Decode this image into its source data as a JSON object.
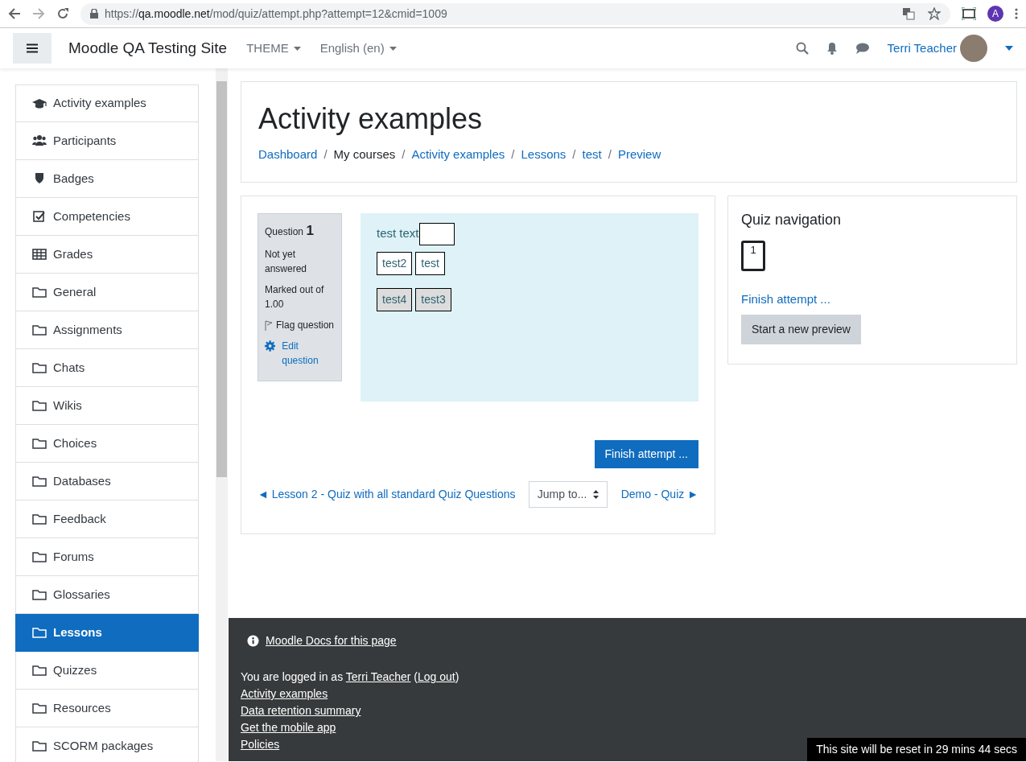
{
  "browser": {
    "url_scheme": "https://",
    "url_host": "qa.moodle.net",
    "url_path": "/mod/quiz/attempt.php?attempt=12&cmid=1009",
    "profile_initial": "A"
  },
  "navbar": {
    "site_name": "Moodle QA Testing Site",
    "menus": [
      "THEME",
      "English (en)"
    ],
    "user_name": "Terri Teacher"
  },
  "sidebar": {
    "items": [
      {
        "label": "Activity examples",
        "kind": "course",
        "selected": false
      },
      {
        "label": "Participants",
        "kind": "participants",
        "selected": false
      },
      {
        "label": "Badges",
        "kind": "badges",
        "selected": false
      },
      {
        "label": "Competencies",
        "kind": "competencies",
        "selected": false
      },
      {
        "label": "Grades",
        "kind": "grades",
        "selected": false
      },
      {
        "label": "General",
        "kind": "section",
        "selected": false
      },
      {
        "label": "Assignments",
        "kind": "section",
        "selected": false
      },
      {
        "label": "Chats",
        "kind": "section",
        "selected": false
      },
      {
        "label": "Wikis",
        "kind": "section",
        "selected": false
      },
      {
        "label": "Choices",
        "kind": "section",
        "selected": false
      },
      {
        "label": "Databases",
        "kind": "section",
        "selected": false
      },
      {
        "label": "Feedback",
        "kind": "section",
        "selected": false
      },
      {
        "label": "Forums",
        "kind": "section",
        "selected": false
      },
      {
        "label": "Glossaries",
        "kind": "section",
        "selected": false
      },
      {
        "label": "Lessons",
        "kind": "section",
        "selected": true
      },
      {
        "label": "Quizzes",
        "kind": "section",
        "selected": false
      },
      {
        "label": "Resources",
        "kind": "section",
        "selected": false
      },
      {
        "label": "SCORM packages",
        "kind": "section",
        "selected": false
      }
    ]
  },
  "page_header": {
    "title": "Activity examples",
    "breadcrumbs": [
      {
        "label": "Dashboard",
        "link": true
      },
      {
        "separator": "/",
        "label": "My courses",
        "link": false
      },
      {
        "separator": "/",
        "label": "Activity examples",
        "link": true
      },
      {
        "separator": "/",
        "label": "Lessons",
        "link": true
      },
      {
        "separator": "/",
        "label": "test",
        "link": true
      },
      {
        "separator": "/",
        "label": "Preview",
        "link": true
      }
    ]
  },
  "question": {
    "label": "Question",
    "number": "1",
    "status": "Not yet answered",
    "mark": "Marked out of 1.00",
    "flag": "Flag question",
    "edit": "Edit question",
    "text": "test text",
    "choice_rows": [
      [
        {
          "label": "test2",
          "used": false
        },
        {
          "label": "test",
          "used": false
        }
      ],
      [
        {
          "label": "test4",
          "used": true
        },
        {
          "label": "test3",
          "used": true
        }
      ]
    ]
  },
  "finish_button": "Finish attempt ...",
  "activity_nav": {
    "previous": "◄ Lesson 2 - Quiz with all standard Quiz Questions",
    "jump": "Jump to...",
    "next": "Demo - Quiz ►"
  },
  "quiz_nav": {
    "title": "Quiz navigation",
    "buttons": [
      {
        "label": "1",
        "selected": true
      }
    ],
    "finish_link": "Finish attempt ...",
    "new_preview": "Start a new preview"
  },
  "footer": {
    "docs_link": "Moodle Docs for this page",
    "logged_in": {
      "before": "You are logged in as ",
      "user": "Terri Teacher",
      "middle": " (",
      "logout": "Log out",
      "after": ")"
    },
    "links": [
      "Activity examples",
      "Data retention summary",
      "Get the mobile app",
      "Policies"
    ]
  },
  "reset_notice": "This site will be reset in 29 mins 44 secs"
}
